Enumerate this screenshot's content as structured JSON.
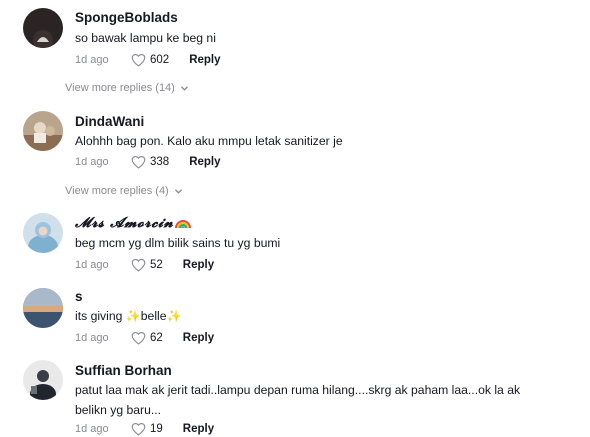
{
  "comments": [
    {
      "username": "SpongeBoblads",
      "text": "so bawak lampu ke beg ni",
      "time": "1d ago",
      "likes": "602",
      "reply_label": "Reply",
      "more_replies": "View more replies (14)"
    },
    {
      "username": "DindaWani",
      "text": "Alohhh bag pon. Kalo aku mmpu letak sanitizer je",
      "time": "1d ago",
      "likes": "338",
      "reply_label": "Reply",
      "more_replies": "View more replies (4)"
    },
    {
      "username": "𝓜𝓻𝓼 𝓐𝓶𝓸𝓻𝓬𝓲𝓷",
      "username_emoji": "rainbow",
      "text": "beg mcm yg dlm bilik sains tu yg bumi",
      "time": "1d ago",
      "likes": "52",
      "reply_label": "Reply"
    },
    {
      "username": "s",
      "text_parts": [
        "its giving ",
        "✨",
        "belle",
        "✨"
      ],
      "time": "1d ago",
      "likes": "62",
      "reply_label": "Reply"
    },
    {
      "username": "Suffian Borhan",
      "text": "patut laa mak ak jerit tadi..lampu depan ruma hilang....skrg ak paham laa...ok la ak belikn yg baru...",
      "time": "1d ago",
      "likes": "19",
      "reply_label": "Reply"
    }
  ],
  "icons": {
    "like": "heart-outline-icon",
    "expand": "chevron-down-icon"
  },
  "colors": {
    "primary_text": "#161823",
    "secondary_text": "#8a8b91"
  }
}
